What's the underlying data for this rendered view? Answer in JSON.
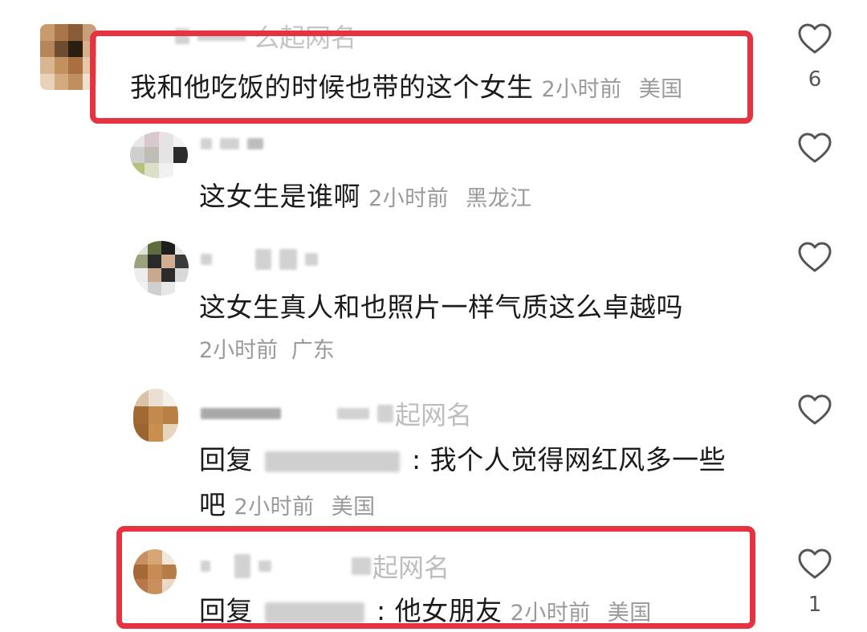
{
  "comments": [
    {
      "username_suffix": "么起网名",
      "text": "我和他吃饭的时候也带的这个女生",
      "time": "2小时前",
      "location": "美国",
      "likes": "6",
      "highlighted": true
    },
    {
      "text": "这女生是谁啊",
      "time": "2小时前",
      "location": "黑龙江",
      "likes": "",
      "highlighted": false
    },
    {
      "text": "这女生真人和也照片一样气质这么卓越吗",
      "time": "2小时前",
      "location": "广东",
      "likes": "",
      "highlighted": false
    },
    {
      "username_suffix": "起网名",
      "reply_prefix": "回复",
      "text_after_mention": ": 我个人觉得网红风多一些",
      "text_line2": "吧",
      "time": "2小时前",
      "location": "美国",
      "likes": "",
      "highlighted": false
    },
    {
      "username_suffix": "起网名",
      "reply_prefix": "回复",
      "text_after_mention": ": 他女朋友",
      "time": "2小时前",
      "location": "美国",
      "likes": "1",
      "highlighted": true
    }
  ],
  "colors": {
    "highlight_border": "#e53342",
    "meta_text": "#9a9a9a",
    "body_text": "#1b1b1b"
  },
  "icons": {
    "like": "heart-outline-icon"
  }
}
